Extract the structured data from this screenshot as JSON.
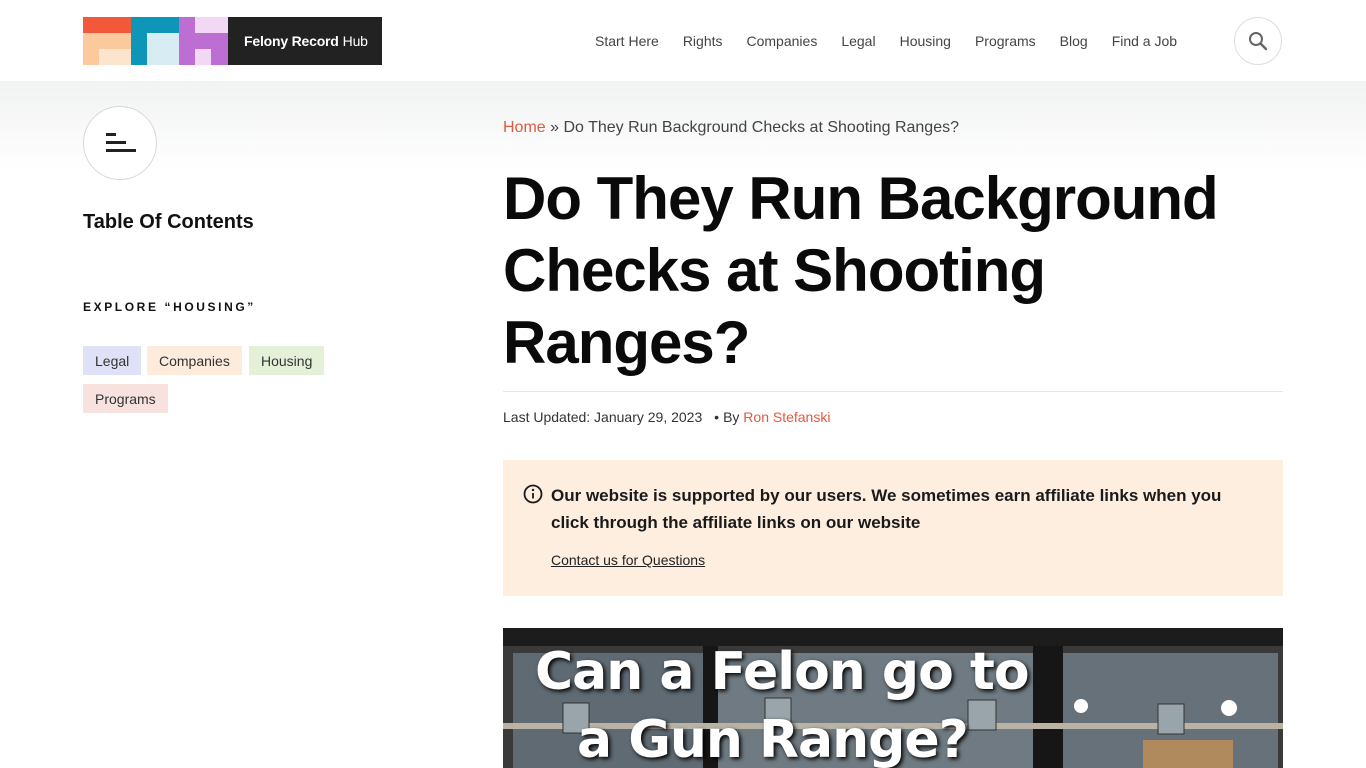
{
  "logo": {
    "brand_name": "Felony Record",
    "brand_suffix": "Hub",
    "colors": [
      "#f2593a",
      "#0e96b8",
      "#bd6ed2",
      "#fbc99b",
      "#fde4cc",
      "#d8ecf4",
      "#f2d8f4"
    ]
  },
  "nav": {
    "items": [
      {
        "label": "Start Here"
      },
      {
        "label": "Rights"
      },
      {
        "label": "Companies"
      },
      {
        "label": "Legal"
      },
      {
        "label": "Housing"
      },
      {
        "label": "Programs"
      },
      {
        "label": "Blog"
      },
      {
        "label": "Find a Job"
      }
    ],
    "search_icon": "search-icon"
  },
  "sidebar": {
    "toc_icon": "table-of-contents-icon",
    "toc_title": "Table Of Contents",
    "explore_label": "EXPLORE “HOUSING”",
    "tags": [
      {
        "label": "Legal",
        "color": "#dfe1f6"
      },
      {
        "label": "Companies",
        "color": "#fdebdc"
      },
      {
        "label": "Housing",
        "color": "#e4f0d8"
      },
      {
        "label": "Programs",
        "color": "#f7e2e0"
      }
    ]
  },
  "breadcrumb": {
    "home": "Home",
    "separator": "»",
    "current": "Do They Run Background Checks at Shooting Ranges?"
  },
  "article": {
    "title_line1": "Do They Run Background",
    "title_line2": "Checks at Shooting",
    "title_line3": "Ranges?",
    "last_updated": "Last Updated: January 29, 2023",
    "by": "By",
    "author": "Ron Stefanski"
  },
  "notice": {
    "icon": "info-icon",
    "message": "Our website is supported by our users. We sometimes earn affiliate links when you click through the affiliate links on our website",
    "contact_link": "Contact us for Questions"
  },
  "hero": {
    "caption_line1": "Can a Felon go to",
    "caption_line2": "a Gun Range?"
  },
  "colors": {
    "accent": "#e05a3e",
    "notice_bg": "#fdeedf"
  }
}
